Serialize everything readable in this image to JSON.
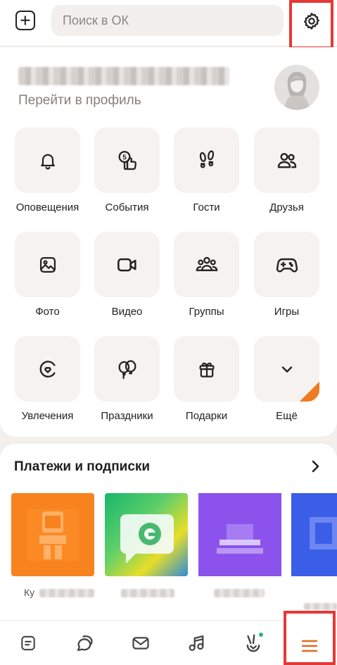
{
  "header": {
    "search_placeholder": "Поиск в ОК"
  },
  "profile": {
    "link_label": "Перейти в профиль"
  },
  "tiles": [
    {
      "label": "Оповещения",
      "icon": "bell-icon"
    },
    {
      "label": "События",
      "icon": "events-icon"
    },
    {
      "label": "Гости",
      "icon": "footprints-icon"
    },
    {
      "label": "Друзья",
      "icon": "friends-icon"
    },
    {
      "label": "Фото",
      "icon": "photo-icon"
    },
    {
      "label": "Видео",
      "icon": "video-icon"
    },
    {
      "label": "Группы",
      "icon": "groups-icon"
    },
    {
      "label": "Игры",
      "icon": "gamepad-icon"
    },
    {
      "label": "Увлечения",
      "icon": "hobbies-icon"
    },
    {
      "label": "Праздники",
      "icon": "balloons-icon"
    },
    {
      "label": "Подарки",
      "icon": "gift-icon"
    },
    {
      "label": "Ещё",
      "icon": "chevron-down-icon"
    }
  ],
  "payments": {
    "title": "Платежи и подписки",
    "first_caption": "Ку"
  },
  "bottom_nav": [
    {
      "name": "feed",
      "icon": "feed-icon"
    },
    {
      "name": "messages",
      "icon": "chat-bubbles-icon"
    },
    {
      "name": "notifications",
      "icon": "envelope-icon"
    },
    {
      "name": "music",
      "icon": "music-note-icon"
    },
    {
      "name": "discover",
      "icon": "discover-icon"
    },
    {
      "name": "menu",
      "icon": "hamburger-icon"
    }
  ],
  "colors": {
    "accent": "#f07a1f",
    "highlight_box": "#e53935",
    "online_dot": "#2bb673",
    "tile_bg": "#f6f2ef"
  }
}
